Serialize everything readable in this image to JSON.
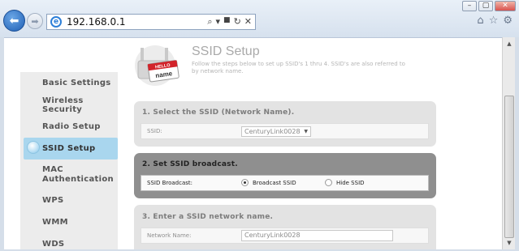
{
  "window": {
    "minimize": "–",
    "restore": "▢",
    "close": "✕"
  },
  "address_bar": {
    "url": "192.168.0.1",
    "search_icon": "⌕",
    "dropdown": "▾",
    "lock": "🔒",
    "refresh": "↻",
    "stop": "✕"
  },
  "toolbar_icons": {
    "home": "⌂",
    "favorites": "☆",
    "tools": "⚙"
  },
  "logo": {
    "badge_top": "HELLO",
    "badge_bottom": "name"
  },
  "page": {
    "title": "SSID Setup",
    "description": "Follow the steps below to set up SSID's 1 thru 4. SSID's are also referred to by network name."
  },
  "sidebar": {
    "items": [
      {
        "label": "Basic Settings"
      },
      {
        "label": "Wireless Security"
      },
      {
        "label": "Radio Setup"
      },
      {
        "label": "SSID Setup"
      },
      {
        "label": "MAC Authentication"
      },
      {
        "label": "WPS"
      },
      {
        "label": "WMM"
      },
      {
        "label": "WDS"
      }
    ]
  },
  "sections": {
    "select_ssid": {
      "title": "1. Select the SSID (Network Name).",
      "label": "SSID:",
      "value": "CenturyLink0028"
    },
    "broadcast": {
      "title": "2. Set SSID broadcast.",
      "label": "SSID Broadcast:",
      "option_broadcast": "Broadcast SSID",
      "option_hide": "Hide SSID"
    },
    "network_name": {
      "title": "3. Enter a SSID network name.",
      "label": "Network Name:",
      "value": "CenturyLink0028"
    }
  },
  "colors": {
    "accent_active": "#a9d6ee",
    "section_active": "#8f8f8f"
  }
}
